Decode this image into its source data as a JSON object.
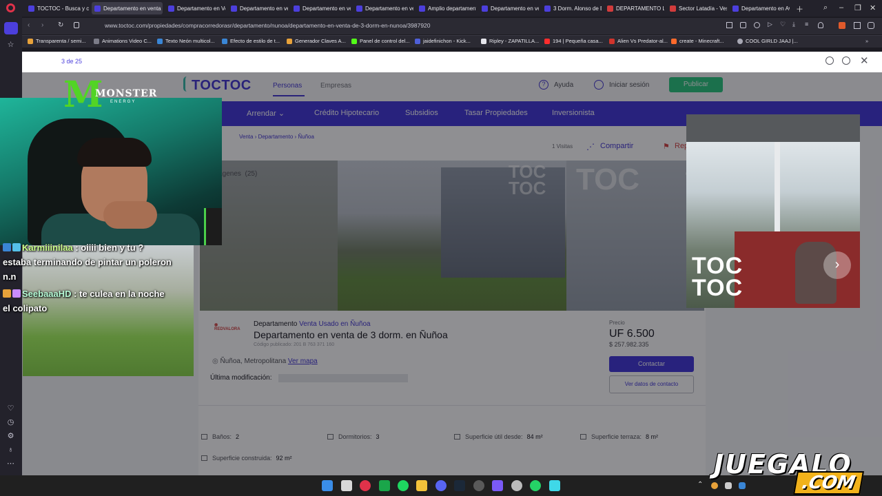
{
  "browser": {
    "tabs": [
      "TOCTOC - Busca y co",
      "Departamento en venta d",
      "Departamento en Ven",
      "Departamento en ven",
      "Departamento en ven",
      "Departamento en ven",
      "Amplio departamento",
      "Departamento en ven",
      "3 Dorm. Alonso de Er",
      "DEPARTAMENTO LAS",
      "Sector Latadía - Vesp",
      "Departamento en Av"
    ],
    "url": "www.toctoc.com/propiedades/compracorredorasr/departamento/nunoa/departamento-en-venta-de-3-dorm-en-nunoa/3987920",
    "bookmarks": [
      "Transparenta / semi...",
      "Animations Video C...",
      "Texto Neón multicol...",
      "Efecto de estilo de t...",
      "Generador Claves A...",
      "Panel de control del...",
      "jaidefinichon - Kick...",
      "Ripley - ZAPATILLA...",
      "194 | Pequeña casa...",
      "Alien Vs Predator-al...",
      "create - Minecraft...",
      "COOL GIRLD JAAJ |..."
    ]
  },
  "viewer": {
    "counter": "3 de 25"
  },
  "site": {
    "logo": "TOCTOC",
    "tab_personas": "Personas",
    "tab_empresas": "Empresas",
    "help": "Ayuda",
    "login": "Iniciar sesión",
    "publish": "Publicar",
    "nav": [
      "Arrendar ⌄",
      "Crédito Hipotecario",
      "Subsidios",
      "Tasar Propiedades",
      "Inversionista"
    ],
    "breadcrumb": "Venta  ›  Departamento  ›  Ñuñoa",
    "visits": "1 Visitas",
    "share": "Compartir",
    "report": "Reportar",
    "images_label": "Imágenes",
    "images_count": "(25)"
  },
  "listing": {
    "type_prefix": "Departamento",
    "type_link": "Venta Usado en Ñuñoa",
    "title": "Departamento en venta de 3 dorm. en Ñuñoa",
    "code": "Código publicado: 201 B 763 371 160",
    "location": "Ñuñoa, Metropolitana",
    "map_link": "Ver mapa",
    "last_mod_label": "Última modificación:",
    "price_label": "Precio",
    "price_uf": "UF 6.500",
    "price_clp": "$ 257.982.335",
    "contact": "Contactar",
    "contact_data": "Ver datos de contacto",
    "features": [
      {
        "label": "Baños:",
        "value": "2"
      },
      {
        "label": "Dormitorios:",
        "value": "3"
      },
      {
        "label": "Superficie útil desde:",
        "value": "84 m²"
      },
      {
        "label": "Superficie terraza:",
        "value": "8 m²"
      },
      {
        "label": "Superficie construida:",
        "value": "92 m²"
      }
    ]
  },
  "stream": {
    "brand": {
      "word": "MONSTER",
      "sub": "ENERGY"
    },
    "chat": [
      {
        "user": "Karmiiinilaa",
        "text": " : oiiii bien y tu ?"
      },
      {
        "user": "",
        "text": "estaba terminando de pintar un poleron"
      },
      {
        "user": "",
        "text": "n.n"
      },
      {
        "user": "SeebaaaHD",
        "text": " : te culea en la noche"
      },
      {
        "user": "",
        "text": "el colipato"
      }
    ],
    "watermark_top": "JUEGALO",
    "watermark_bottom": ".COM"
  },
  "colors": {
    "brand": "#3a2fd6",
    "accent_green": "#52d425",
    "juegalo": "#f2b21b"
  },
  "icons": [
    "search-icon",
    "close-icon",
    "zoom-in-icon",
    "share-icon",
    "flag-icon",
    "heart-icon",
    "chevron-right-icon",
    "location-icon",
    "user-icon",
    "help-icon"
  ]
}
